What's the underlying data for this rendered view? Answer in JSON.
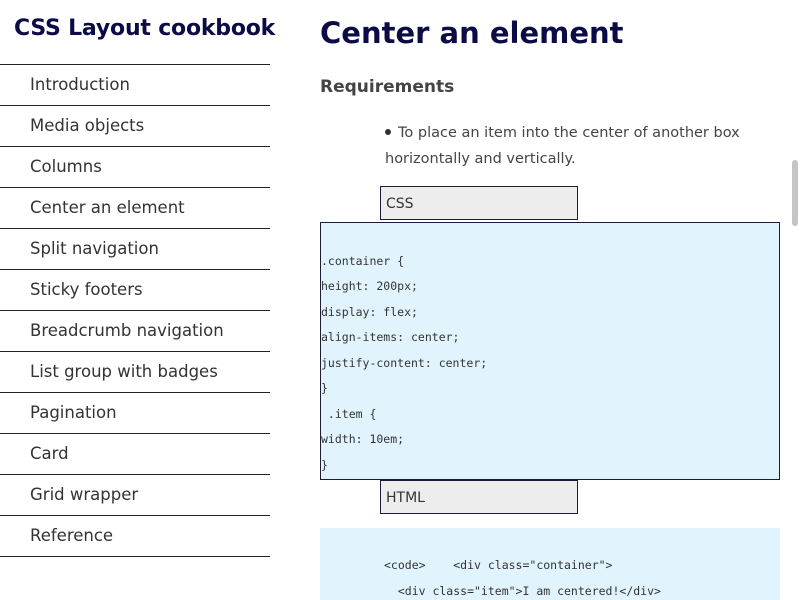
{
  "site": {
    "title": "CSS Layout cookbook"
  },
  "nav": {
    "items": [
      "Introduction",
      "Media objects",
      "Columns",
      "Center an element",
      "Split navigation",
      "Sticky footers",
      "Breadcrumb navigation",
      "List group with badges",
      "Pagination",
      "Card",
      "Grid wrapper",
      "Reference"
    ]
  },
  "main": {
    "title": "Center an element",
    "requirements_heading": "Requirements",
    "requirements": [
      "To place an item into the center of another box horizontally and vertically."
    ],
    "css_tab": "CSS",
    "css_code": [
      ".container {",
      "height: 200px;",
      "display: flex;",
      "align-items: center;",
      "justify-content: center;",
      "}",
      " .item {",
      "width: 10em;",
      "}"
    ],
    "html_tab": "HTML",
    "html_code": [
      "<code>    <div class=\"container\">",
      "  <div class=\"item\">I am centered!</div>"
    ]
  }
}
